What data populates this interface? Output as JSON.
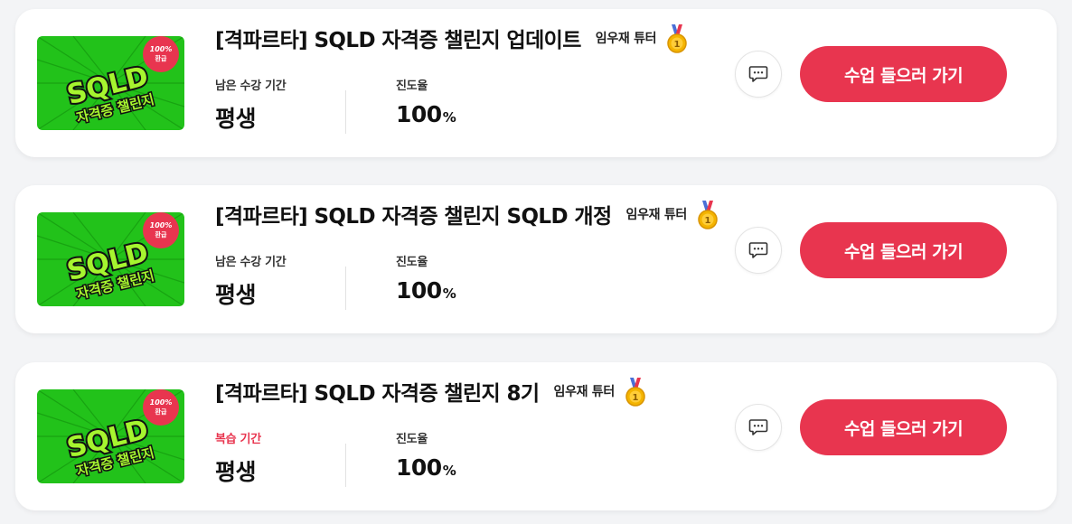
{
  "courses": [
    {
      "title": "[격파르타] SQLD 자격증 챌린지 업데이트",
      "tutor": "임우재 튜터",
      "period_label": "남은 수강 기간",
      "period_value": "평생",
      "progress_label": "진도율",
      "progress_value": "100",
      "progress_unit": "%",
      "button_label": "수업 들으러 가기",
      "period_label_color": "#333333"
    },
    {
      "title": "[격파르타] SQLD 자격증 챌린지 SQLD 개정",
      "tutor": "임우재 튜터",
      "period_label": "남은 수강 기간",
      "period_value": "평생",
      "progress_label": "진도율",
      "progress_value": "100",
      "progress_unit": "%",
      "button_label": "수업 들으러 가기",
      "period_label_color": "#333333"
    },
    {
      "title": "[격파르타] SQLD 자격증 챌린지 8기",
      "tutor": "임우재 튜터",
      "period_label": "복습 기간",
      "period_value": "평생",
      "progress_label": "진도율",
      "progress_value": "100",
      "progress_unit": "%",
      "button_label": "수업 들으러 가기",
      "period_label_color": "#e8354f"
    }
  ],
  "thumbnail": {
    "main_text": "SQLD",
    "sub_text": "자격증 챌린지",
    "badge_line1": "100%",
    "badge_line2": "환급"
  },
  "colors": {
    "accent": "#e8354f",
    "thumbnail_green": "#22c21a",
    "thumbnail_lime": "#a6f52f",
    "medal_gold": "#f4b400"
  },
  "icons": {
    "chat": "chat-bubble-icon",
    "medal": "gold-medal-icon"
  }
}
